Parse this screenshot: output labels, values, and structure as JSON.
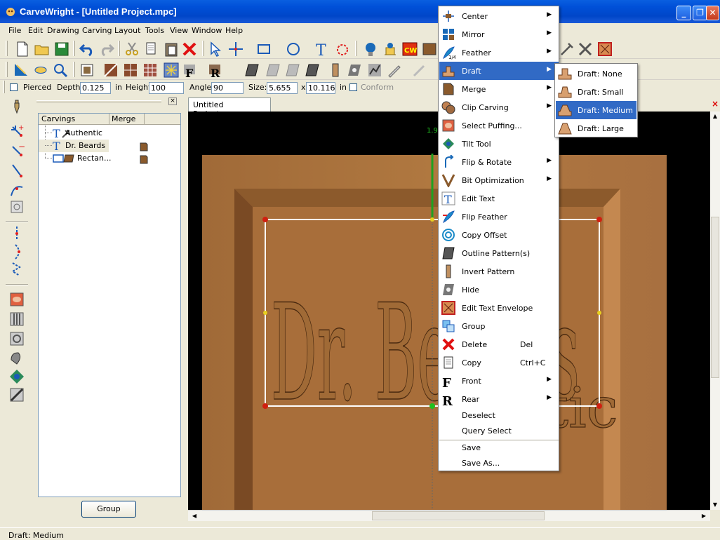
{
  "window": {
    "title": "CarveWright - [Untitled Project.mpc]"
  },
  "menubar": [
    "File",
    "Edit",
    "Drawing",
    "Carving",
    "Layout",
    "Tools",
    "View",
    "Window",
    "Help"
  ],
  "properties": {
    "pierced_label": "Pierced",
    "depth_label": "Depth:",
    "depth_value": "0.125",
    "in1": "in",
    "height_label": "Height:",
    "height_value": "100",
    "angle_label": "Angle:",
    "angle_value": "90",
    "size_label": "Size:",
    "size_w": "5.655",
    "size_x": "x",
    "size_h": "10.116",
    "in2": "in",
    "conform_label": "Conform"
  },
  "panel": {
    "headers": [
      "Carvings",
      "Merge"
    ],
    "items": [
      "Authentic",
      "Dr. Beards",
      "Rectan..."
    ],
    "group_button": "Group"
  },
  "document": {
    "tab": "Untitled Project.mpc",
    "measure_label": "1.9",
    "carved_text": "Dr. Beards",
    "carved_text2": "tic"
  },
  "context_menu": {
    "items": [
      {
        "label": "Center",
        "arrow": true,
        "icon": "center-icon"
      },
      {
        "label": "Mirror",
        "arrow": true,
        "icon": "mirror-icon"
      },
      {
        "label": "Feather",
        "arrow": true,
        "icon": "feather-icon"
      },
      {
        "label": "Draft",
        "arrow": true,
        "icon": "draft-icon",
        "selected": true
      },
      {
        "label": "Merge",
        "arrow": true,
        "icon": "merge-icon"
      },
      {
        "label": "Clip Carving",
        "arrow": true,
        "icon": "clip-carving-icon"
      },
      {
        "label": "Select Puffing...",
        "icon": "puffing-icon"
      },
      {
        "label": "Tilt Tool",
        "icon": "tilt-tool-icon"
      },
      {
        "label": "Flip & Rotate",
        "arrow": true,
        "icon": "flip-rotate-icon"
      },
      {
        "label": "Bit Optimization",
        "arrow": true,
        "icon": "bit-optimization-icon"
      },
      {
        "label": "Edit Text",
        "icon": "edit-text-icon"
      },
      {
        "label": "Flip Feather",
        "icon": "flip-feather-icon"
      },
      {
        "label": "Copy Offset",
        "icon": "copy-offset-icon"
      },
      {
        "label": "Outline Pattern(s)",
        "icon": "outline-pattern-icon"
      },
      {
        "label": "Invert Pattern",
        "icon": "invert-pattern-icon"
      },
      {
        "label": "Hide",
        "icon": "hide-icon"
      },
      {
        "label": "Edit Text Envelope",
        "icon": "edit-envelope-icon"
      },
      {
        "label": "Group",
        "icon": "group-icon"
      },
      {
        "label": "Delete",
        "shortcut": "Del",
        "icon": "delete-icon"
      },
      {
        "label": "Copy",
        "shortcut": "Ctrl+C",
        "icon": "copy-icon"
      },
      {
        "label": "Front",
        "arrow": true,
        "icon": "front-icon"
      },
      {
        "label": "Rear",
        "arrow": true,
        "icon": "rear-icon"
      },
      {
        "label": "Deselect"
      },
      {
        "label": "Query Select"
      },
      {
        "label": "Save"
      },
      {
        "label": "Save As..."
      }
    ]
  },
  "draft_submenu": [
    "Draft: None",
    "Draft: Small",
    "Draft: Medium",
    "Draft: Large"
  ],
  "draft_selected": "Draft: Medium",
  "status": "Draft: Medium",
  "colors": {
    "title_blue": "#0050d8",
    "selection_blue": "#316ac5",
    "wood": "#b07840",
    "wood_dark": "#8c5a2c"
  }
}
